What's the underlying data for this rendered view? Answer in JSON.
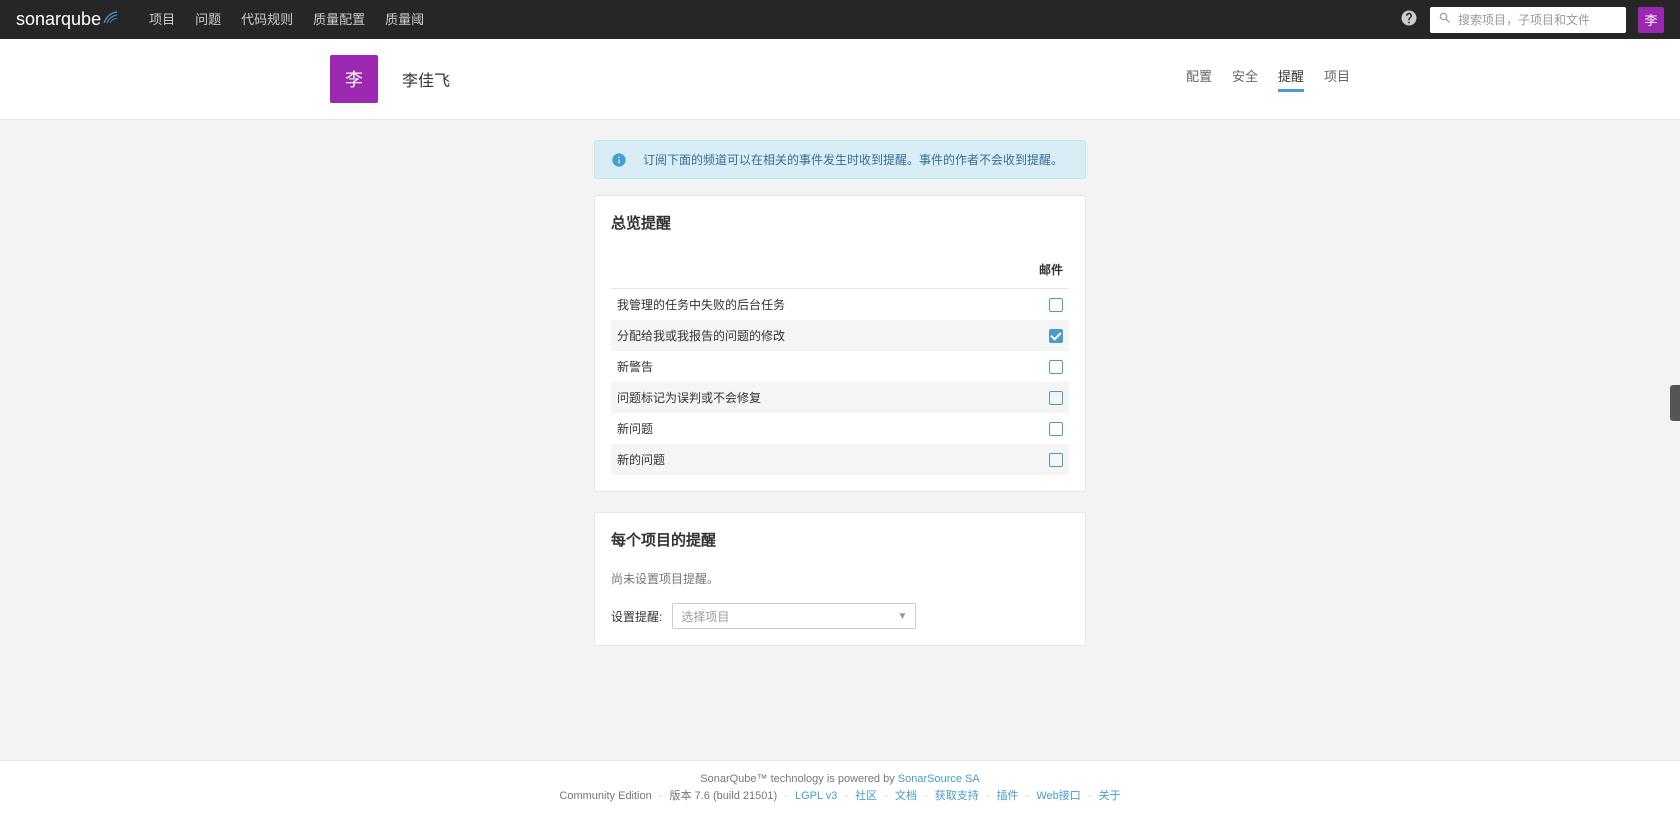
{
  "brand": {
    "part1": "sonar",
    "part2": "qube"
  },
  "nav": {
    "items": [
      "项目",
      "问题",
      "代码规则",
      "质量配置",
      "质量阈"
    ]
  },
  "search": {
    "placeholder": "搜索项目，子项目和文件"
  },
  "user_avatar_letter": "李",
  "profile": {
    "avatar_letter": "李",
    "name": "李佳飞"
  },
  "sub_tabs": [
    "配置",
    "安全",
    "提醒",
    "项目"
  ],
  "active_sub_tab": 2,
  "info_banner": "订阅下面的频道可以在相关的事件发生时收到提醒。事件的作者不会收到提醒。",
  "overview": {
    "title": "总览提醒",
    "email_header": "邮件",
    "rows": [
      {
        "label": "我管理的任务中失败的后台任务",
        "checked": false
      },
      {
        "label": "分配给我或我报告的问题的修改",
        "checked": true
      },
      {
        "label": "新警告",
        "checked": false
      },
      {
        "label": "问题标记为误判或不会修复",
        "checked": false
      },
      {
        "label": "新问题",
        "checked": false
      },
      {
        "label": "新的问题",
        "checked": false
      }
    ]
  },
  "per_project": {
    "title": "每个项目的提醒",
    "empty": "尚未设置项目提醒。",
    "select_label": "设置提醒:",
    "select_placeholder": "选择项目"
  },
  "footer": {
    "line1_prefix": "SonarQube™ technology is powered by ",
    "line1_link": "SonarSource SA",
    "edition": "Community Edition",
    "version": "版本 7.6 (build 21501)",
    "license": "LGPL v3",
    "links": [
      "社区",
      "文档",
      "获取支持",
      "插件",
      "Web接口",
      "关于"
    ]
  }
}
